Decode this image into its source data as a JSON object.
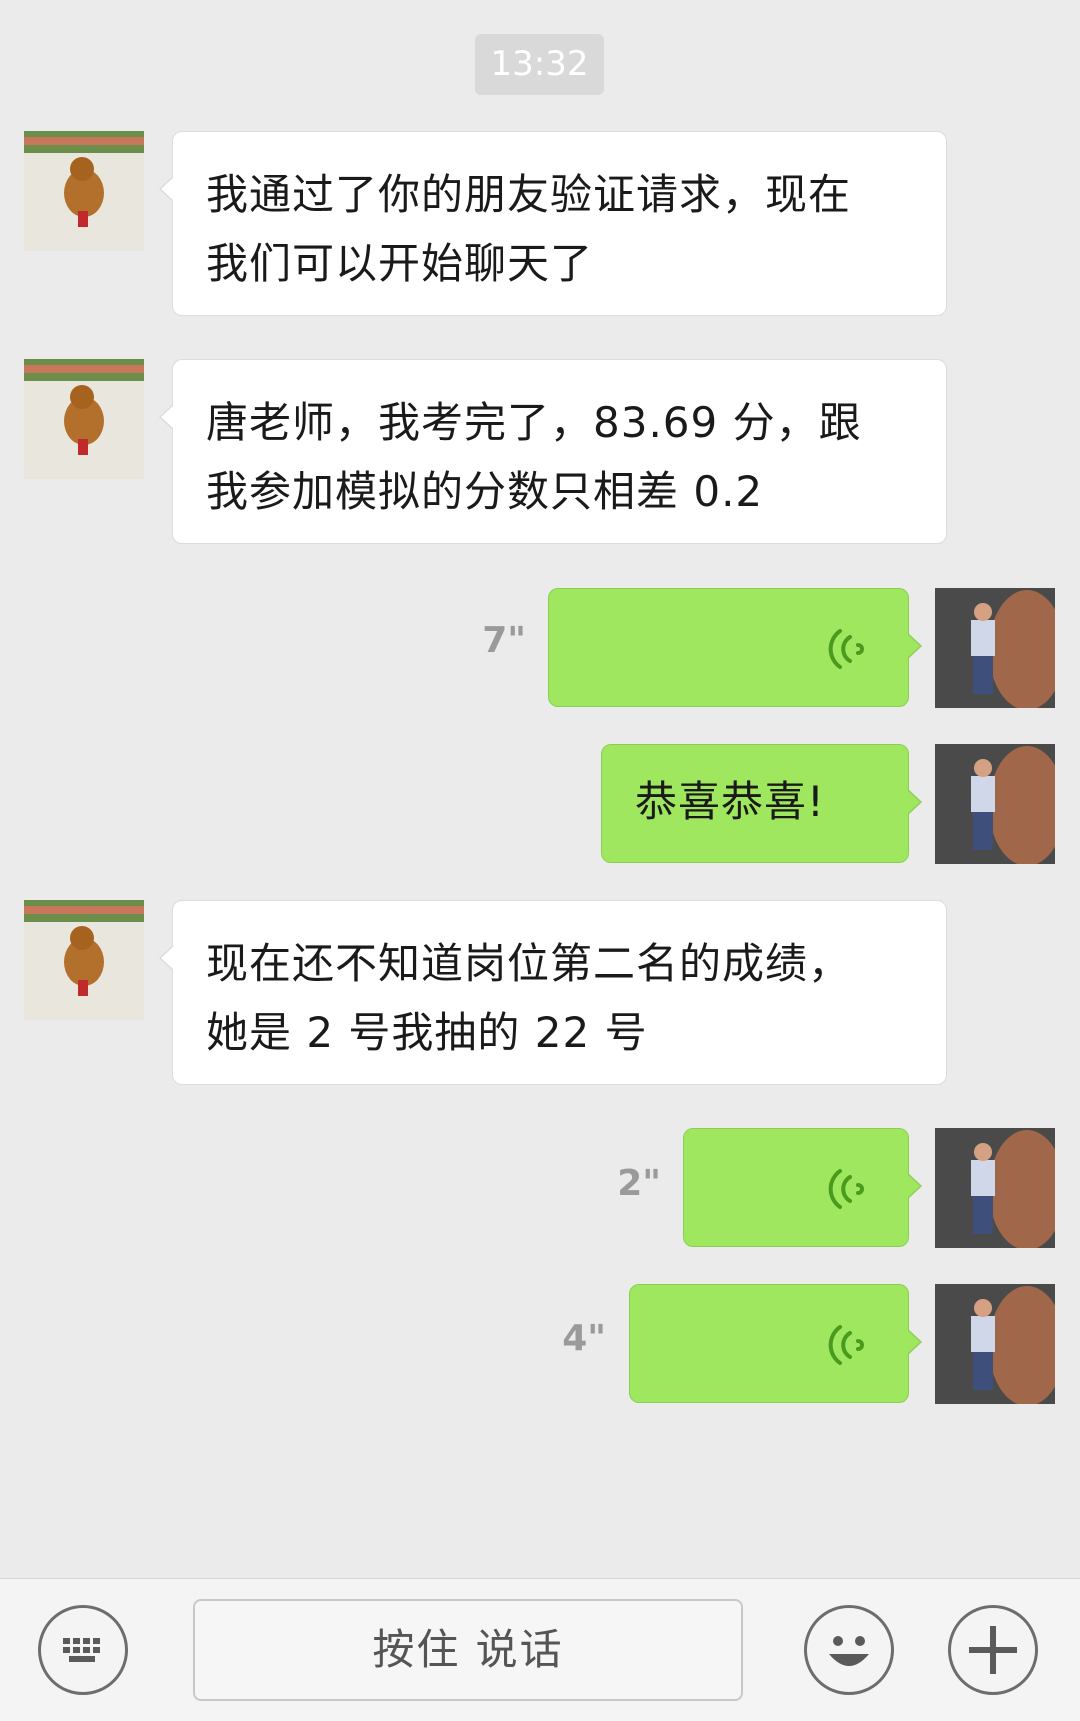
{
  "timestamp": "13:32",
  "messages": [
    {
      "side": "in",
      "type": "text",
      "text_lines": [
        "我通过了你的朋友验证请求，现在",
        "我们可以开始聊天了"
      ]
    },
    {
      "side": "in",
      "type": "text",
      "text_lines": [
        "唐老师，我考完了，83.69 分，跟",
        "我参加模拟的分数只相差 0.2"
      ]
    },
    {
      "side": "out",
      "type": "voice",
      "duration": "7\""
    },
    {
      "side": "out",
      "type": "text",
      "text_lines": [
        "恭喜恭喜!"
      ]
    },
    {
      "side": "in",
      "type": "text",
      "text_lines": [
        "现在还不知道岗位第二名的成绩，",
        "她是 2 号我抽的 22 号"
      ]
    },
    {
      "side": "out",
      "type": "voice",
      "duration": "2\""
    },
    {
      "side": "out",
      "type": "voice",
      "duration": "4\""
    }
  ],
  "input_bar": {
    "keyboard_icon": "keyboard-icon",
    "hold_to_talk": "按住 说话",
    "emoji_icon": "emoji-icon",
    "add_icon": "plus-icon"
  },
  "colors": {
    "background": "#ebebeb",
    "incoming_bubble": "#ffffff",
    "outgoing_bubble": "#9ee75f",
    "voice_wave": "#4a9a1e",
    "timestamp_pill": "#d9d9d9"
  }
}
